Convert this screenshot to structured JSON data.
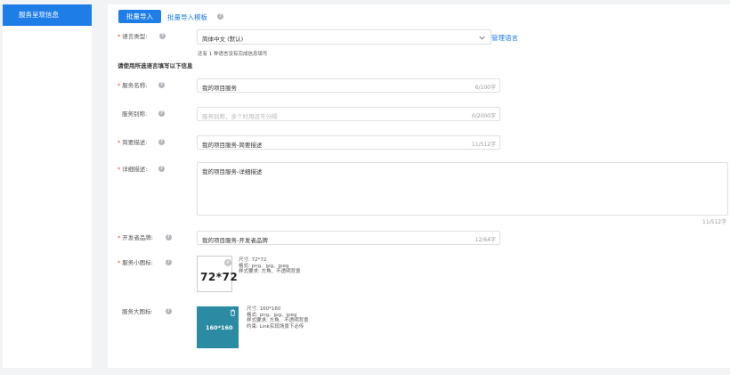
{
  "sidebar": {
    "items": [
      {
        "label": "服务呈现信息"
      }
    ]
  },
  "toolbar": {
    "import_button": "批量导入",
    "template_link": "批量导入模板"
  },
  "language": {
    "label": "语言类型:",
    "value": "简体中文 (默认)",
    "manage_link": "管理语言",
    "note": "还有 1 种语言没有完成信息填写"
  },
  "section_title": "请使用所选语言填写以下信息",
  "fields": {
    "service_name": {
      "label": "服务名称:",
      "value": "我的项目服务",
      "count": "6/100字",
      "required": true
    },
    "alias": {
      "label": "服务别称:",
      "placeholder": "服务别称，多个时用逗号分隔",
      "count": "0/2000字",
      "required": false
    },
    "brief": {
      "label": "简要描述:",
      "value": "我的项目服务-简要描述",
      "count": "11/512字",
      "required": true
    },
    "detail": {
      "label": "详细描述:",
      "value": "我的项目服务-详细描述",
      "count": "11/512字",
      "required": true
    },
    "brand": {
      "label": "开发者品牌:",
      "value": "我的项目服务-开发者品牌",
      "count": "12/64字",
      "required": true
    }
  },
  "small_icon": {
    "label": "服务小图标:",
    "preview_text": "72*72",
    "specs": [
      "尺寸: 72*72",
      "格式: png、jpg、jpeg",
      "样式要求: 方角、不透明背景"
    ]
  },
  "large_icon": {
    "label": "服务大图标:",
    "preview_text": "160*160",
    "specs": [
      "尺寸: 160*160",
      "格式: png、jpg、jpeg",
      "样式要求: 方角、不透明背景",
      "约束: Link实现场景下必传"
    ]
  },
  "colors": {
    "accent": "#1e7de6",
    "required": "#e74c3c",
    "large_icon_bg": "#2b8ba3"
  }
}
